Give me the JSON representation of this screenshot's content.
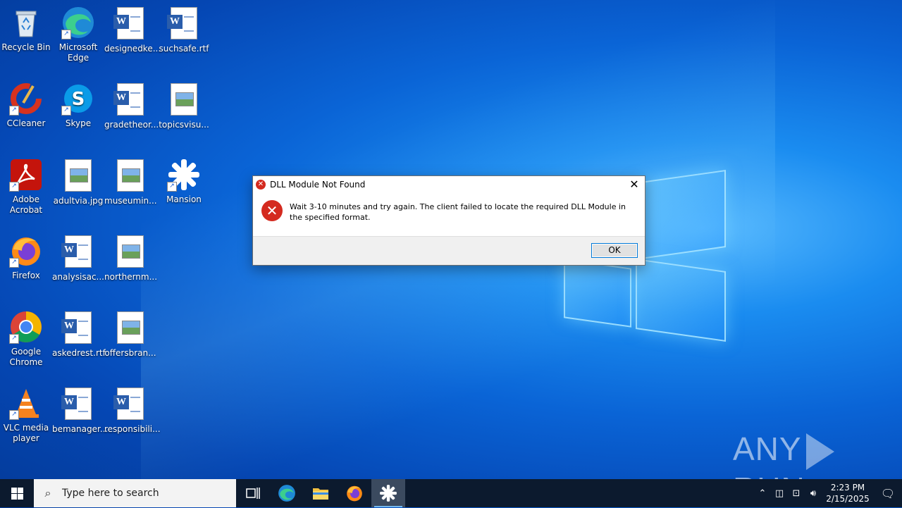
{
  "desktop": {
    "icons": [
      {
        "label": "Recycle Bin",
        "icon": "recycle-bin-icon"
      },
      {
        "label": "Microsoft Edge",
        "icon": "edge-icon"
      },
      {
        "label": "designedke...",
        "icon": "word-doc-icon"
      },
      {
        "label": "suchsafe.rtf",
        "icon": "word-doc-icon"
      },
      {
        "label": "CCleaner",
        "icon": "ccleaner-icon"
      },
      {
        "label": "Skype",
        "icon": "skype-icon"
      },
      {
        "label": "gradetheor...",
        "icon": "word-doc-icon"
      },
      {
        "label": "topicsvisu...",
        "icon": "image-file-icon"
      },
      {
        "label": "Adobe Acrobat",
        "icon": "acrobat-icon"
      },
      {
        "label": "adultvia.jpg",
        "icon": "image-file-icon"
      },
      {
        "label": "museumin...",
        "icon": "image-file-icon"
      },
      {
        "label": "Mansion",
        "icon": "mansion-app-icon"
      },
      {
        "label": "Firefox",
        "icon": "firefox-icon"
      },
      {
        "label": "analysisac...",
        "icon": "word-doc-icon"
      },
      {
        "label": "northernm...",
        "icon": "image-file-icon"
      },
      {
        "label": "Google Chrome",
        "icon": "chrome-icon"
      },
      {
        "label": "askedrest.rtf",
        "icon": "word-doc-icon"
      },
      {
        "label": "offersbran...",
        "icon": "image-file-icon"
      },
      {
        "label": "VLC media player",
        "icon": "vlc-icon"
      },
      {
        "label": "bemanager...",
        "icon": "word-doc-icon"
      },
      {
        "label": "responsibili...",
        "icon": "word-doc-icon"
      }
    ]
  },
  "dialog": {
    "title": "DLL Module Not Found",
    "message": "Wait 3-10 minutes and try again. The client failed to locate the required DLL Module in the specified format.",
    "close_glyph": "✕",
    "ok_label": "OK"
  },
  "watermark": {
    "left": "ANY",
    "right": "RUN"
  },
  "taskbar": {
    "search_placeholder": "Type here to search",
    "pinned": [
      "task-view-icon",
      "edge-icon",
      "file-explorer-icon",
      "firefox-icon",
      "mansion-app-icon"
    ],
    "active_app": "mansion-app-icon",
    "time": "2:23 PM",
    "date": "2/15/2025"
  },
  "colors": {
    "accent": "#0078d7",
    "error": "#d42a1f",
    "taskbar": "#0c1a2e"
  }
}
